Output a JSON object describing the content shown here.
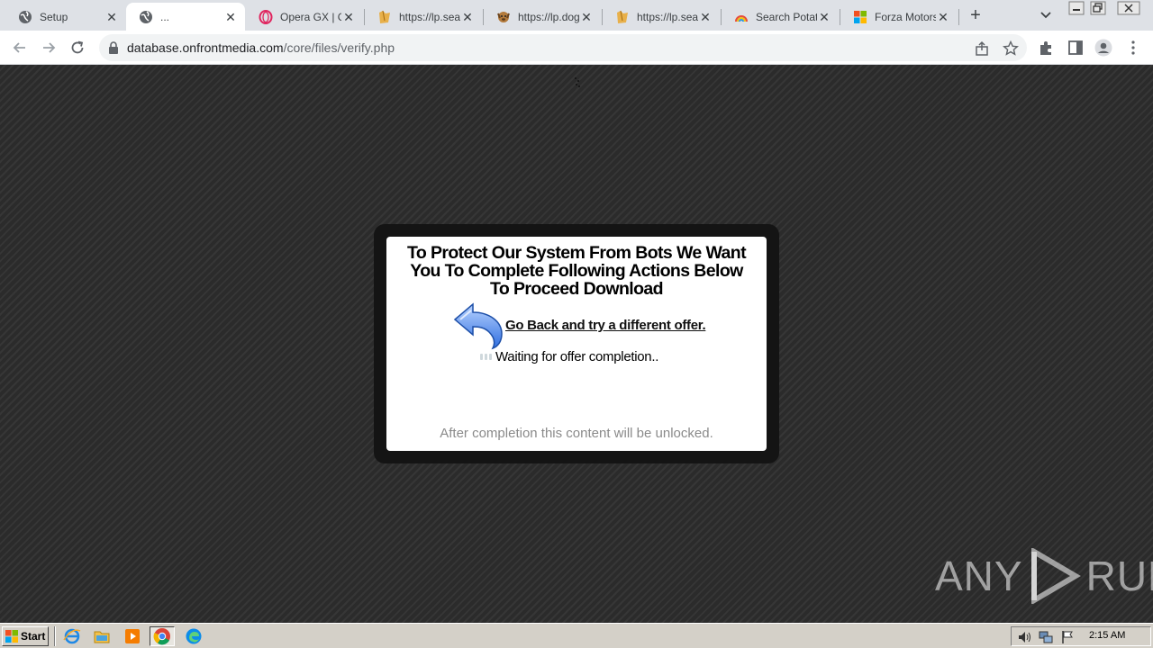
{
  "browser": {
    "tabs": [
      {
        "title": "Setup",
        "icon": "globe-icon",
        "active": false
      },
      {
        "title": "...",
        "icon": "globe-icon",
        "active": true
      },
      {
        "title": "Opera GX | Ga",
        "icon": "opera-icon",
        "active": false
      },
      {
        "title": "https://lp.sea",
        "icon": "folder-icon",
        "active": false
      },
      {
        "title": "https://lp.dog",
        "icon": "dog-icon",
        "active": false
      },
      {
        "title": "https://lp.sea",
        "icon": "folder-icon",
        "active": false
      },
      {
        "title": "Search Potato",
        "icon": "rainbow-icon",
        "active": false
      },
      {
        "title": "Forza Motorsp",
        "icon": "microsoft-icon",
        "active": false
      }
    ],
    "close_glyph": "✕",
    "new_tab_glyph": "+",
    "url_host": "database.onfrontmedia.com",
    "url_path": "/core/files/verify.php"
  },
  "page": {
    "title": "To Protect Our System From Bots We Want You To Complete Following Actions Below To Proceed Download",
    "back_link": "Go Back and try a different offer.",
    "waiting": "Waiting for offer completion..",
    "unlock_note": "After completion this content will be unlocked.",
    "watermark_left": "ANY",
    "watermark_right": "RUN"
  },
  "taskbar": {
    "start_label": "Start",
    "clock": "2:15 AM"
  },
  "colors": {
    "page_background": "#2b2b2b",
    "modal_frame": "#141414",
    "modal_body": "#ffffff",
    "tabstrip": "#dee1e6"
  }
}
